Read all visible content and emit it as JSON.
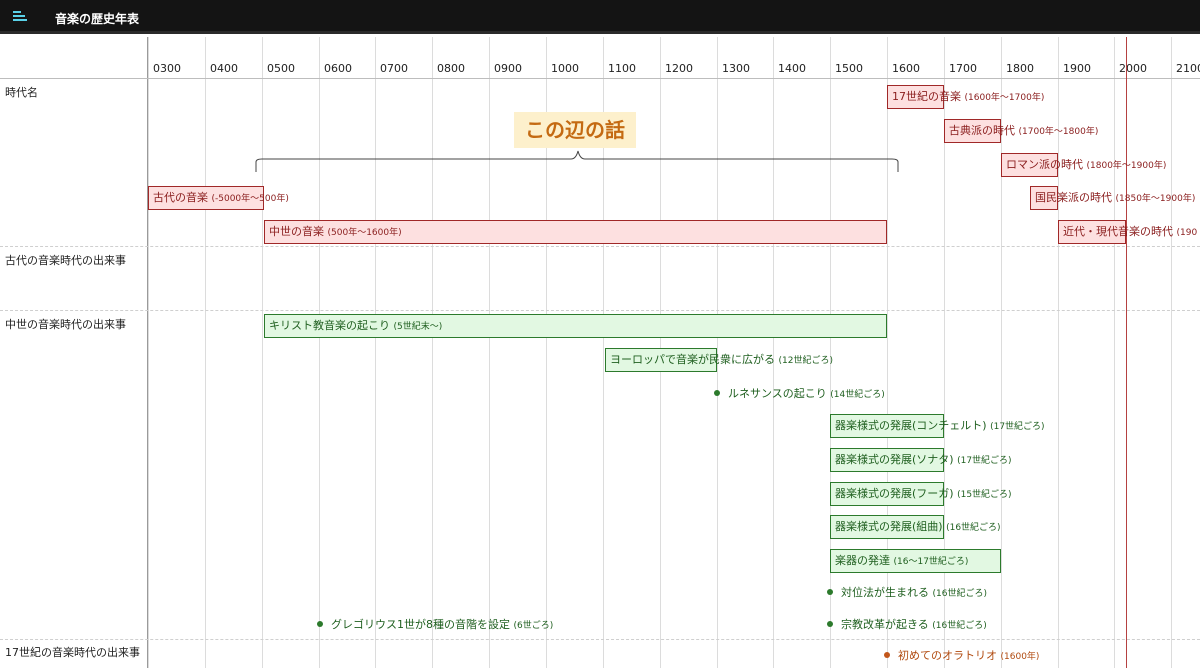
{
  "app": {
    "title": "音楽の歴史年表",
    "icon": "menu-list-icon"
  },
  "timeline": {
    "years": [
      "0300",
      "0400",
      "0500",
      "0600",
      "0700",
      "0800",
      "0900",
      "1000",
      "1100",
      "1200",
      "1300",
      "1400",
      "1500",
      "1600",
      "1700",
      "1800",
      "1900",
      "2000",
      "2100"
    ],
    "rows": [
      "時代名",
      "古代の音楽時代の出来事",
      "中世の音楽時代の出来事",
      "17世紀の音楽時代の出来事"
    ],
    "current_marker_year": "2000"
  },
  "callout": "この辺の話",
  "eras": [
    {
      "label": "17世紀の音楽",
      "range": "(1600年～1700年)"
    },
    {
      "label": "古典派の時代",
      "range": "(1700年～1800年)"
    },
    {
      "label": "ロマン派の時代",
      "range": "(1800年～1900年)"
    },
    {
      "label": "古代の音楽",
      "range": "(-5000年～500年)"
    },
    {
      "label": "国民楽派の時代",
      "range": "(1850年～1900年)"
    },
    {
      "label": "中世の音楽",
      "range": "(500年～1600年)"
    },
    {
      "label": "近代・現代音楽の時代",
      "range": "(190"
    }
  ],
  "events": [
    {
      "label": "キリスト教音楽の起こり",
      "range": "(5世紀末〜)"
    },
    {
      "label": "ヨーロッパで音楽が民衆に広がる",
      "range": "(12世紀ごろ)"
    },
    {
      "label": "器楽様式の発展(コンチェルト)",
      "range": "(17世紀ごろ)"
    },
    {
      "label": "器楽様式の発展(ソナタ)",
      "range": "(17世紀ごろ)"
    },
    {
      "label": "器楽様式の発展(フーガ)",
      "range": "(15世紀ごろ)"
    },
    {
      "label": "器楽様式の発展(組曲)",
      "range": "(16世紀ごろ)"
    },
    {
      "label": "楽器の発達",
      "range": "(16～17世紀ごろ)"
    }
  ],
  "points": [
    {
      "label": "ルネサンスの起こり",
      "range": "(14世紀ごろ)"
    },
    {
      "label": "対位法が生まれる",
      "range": "(16世紀ごろ)"
    },
    {
      "label": "グレゴリウス1世が8種の音階を設定",
      "range": "(6世ごろ)"
    },
    {
      "label": "宗教改革が起きる",
      "range": "(16世紀ごろ)"
    },
    {
      "label": "初めてのオラトリオ",
      "range": "(1600年)"
    }
  ]
}
